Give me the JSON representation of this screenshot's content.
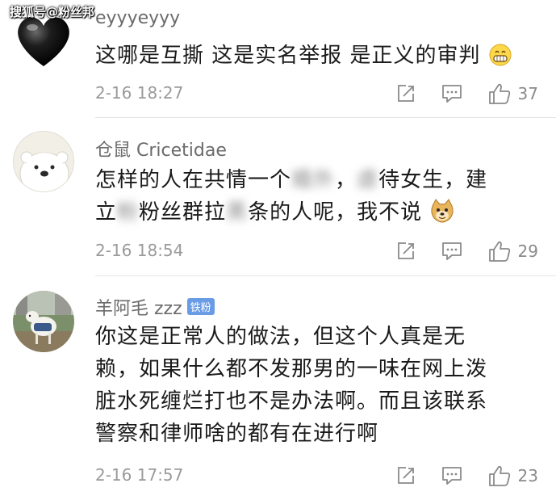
{
  "watermark": "搜狐号@粉丝邦",
  "comments": [
    {
      "username": "eyyyeyyy",
      "lines": [
        "这哪是互撕 这是实名举报 是正义的审判"
      ],
      "time": "2-16 18:27",
      "likes": "37",
      "avatar_icon": "black-heart-icon",
      "emoji_icon": "grinning-face-icon"
    },
    {
      "username": "仓鼠 Cricetidae",
      "line1_a": "怎样的人在共情一个",
      "line1_blur1": "婚外",
      "line1_b": "，",
      "line1_blur2": "虐",
      "line1_c": "待女生，建",
      "line2_a": "立",
      "line2_blur1": "粉",
      "line2_b": "粉丝群拉",
      "line2_blur2": "黑",
      "line2_c": "条的人呢，我不说",
      "time": "2-16 18:54",
      "likes": "29",
      "avatar_icon": "polar-bear-avatar",
      "emoji_icon": "doge-face-icon"
    },
    {
      "username": "羊阿毛 zzz",
      "badge": "铁粉",
      "lines": [
        "你这是正常人的做法，但这个人真是无",
        "赖，如果什么都不发那男的一味在网上泼",
        "脏水死缠烂打也不是办法啊。而且该联系",
        "警察和律师啥的都有在进行啊"
      ],
      "time": "2-16 17:57",
      "likes": "23",
      "avatar_icon": "lamb-photo-avatar"
    }
  ]
}
